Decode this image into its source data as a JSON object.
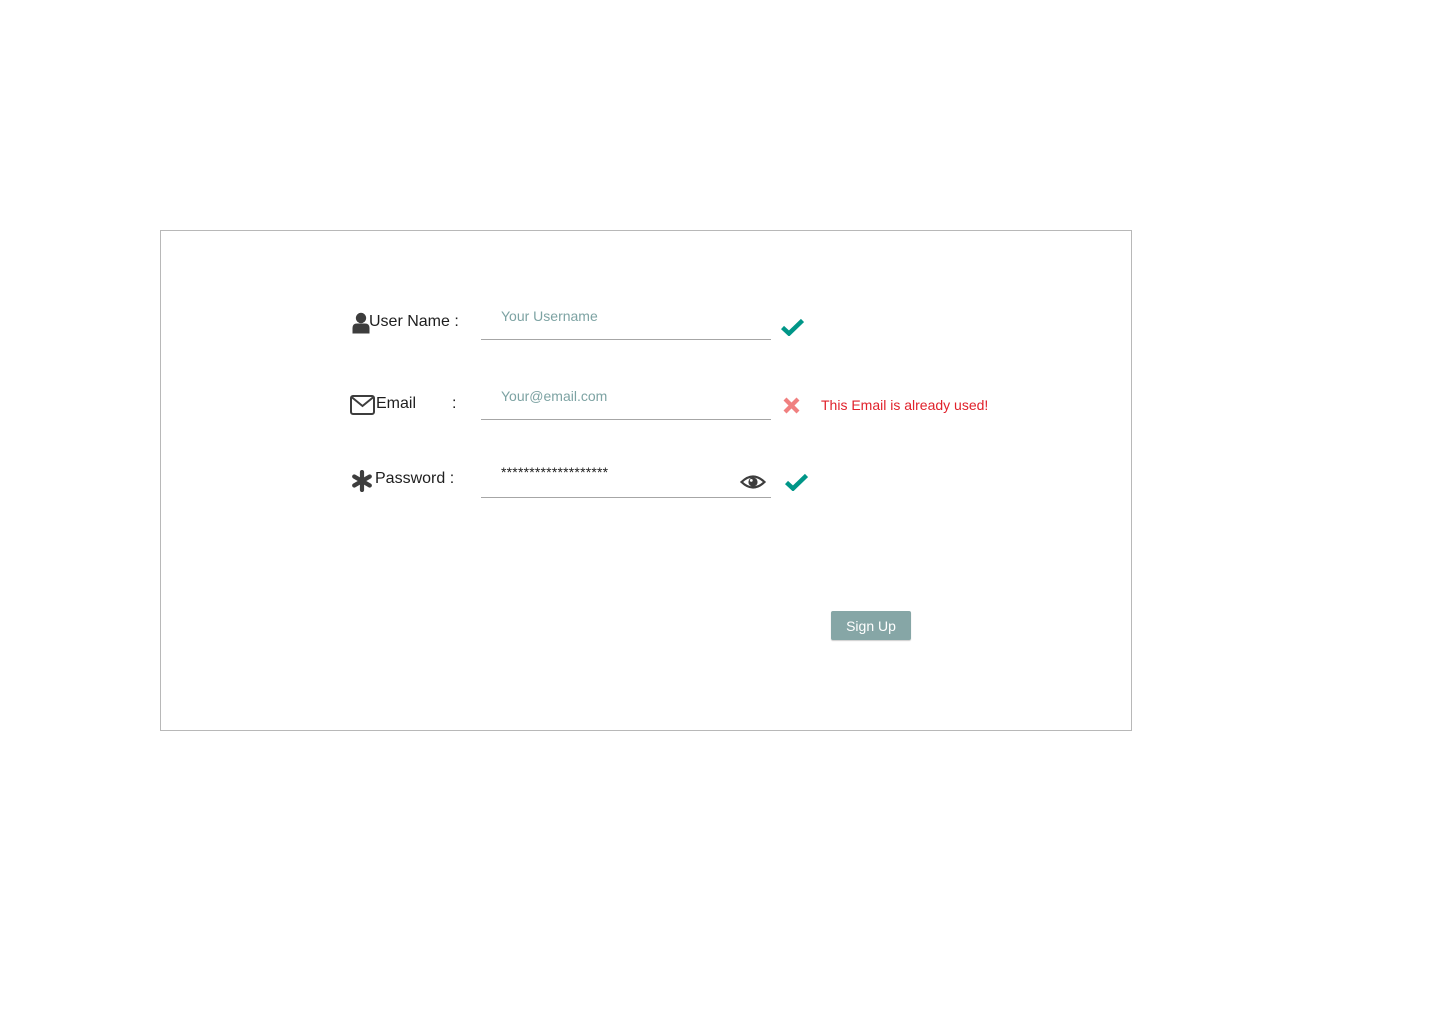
{
  "form": {
    "username": {
      "label": "User Name :",
      "placeholder": "Your Username",
      "value": "",
      "icon": "user-icon",
      "status": "valid",
      "status_icon": "check-icon"
    },
    "email": {
      "label": "Email",
      "colon": ":",
      "placeholder": "Your@email.com",
      "value": "",
      "icon": "envelope-icon",
      "status": "error",
      "status_icon": "cross-icon",
      "error_message": "This Email is already used!"
    },
    "password": {
      "label": "Password :",
      "masked_value": "*******************",
      "icon": "asterisk-icon",
      "toggle_icon": "eye-icon",
      "status": "valid",
      "status_icon": "check-icon"
    },
    "submit_label": "Sign Up"
  },
  "colors": {
    "valid": "#009688",
    "error_icon": "#f08080",
    "error_text": "#e0212b",
    "button_bg": "#86a6a6",
    "placeholder": "#7da3a3"
  }
}
